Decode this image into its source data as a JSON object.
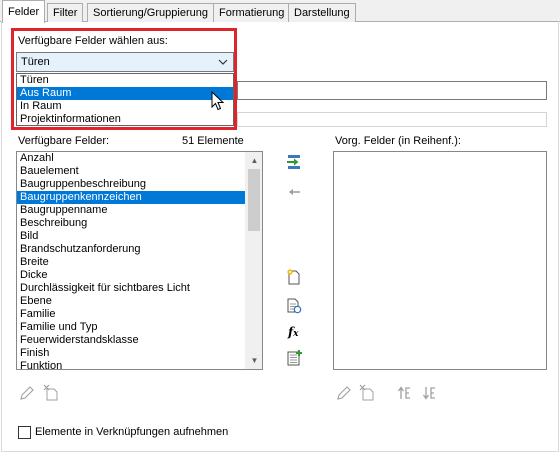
{
  "tabs": [
    "Felder",
    "Filter",
    "Sortierung/Gruppierung",
    "Formatierung",
    "Darstellung"
  ],
  "category_label": "Verfügbare Felder wählen aus:",
  "category_combo_value": "Türen",
  "category_options": [
    "Türen",
    "Aus Raum",
    "In Raum",
    "Projektinformationen"
  ],
  "available_label": "Verfügbare Felder:",
  "count_label": "51 Elemente",
  "available_fields": [
    "Anzahl",
    "Bauelement",
    "Baugruppenbeschreibung",
    "Baugruppenkennzeichen",
    "Baugruppenname",
    "Beschreibung",
    "Bild",
    "Brandschutzanforderung",
    "Breite",
    "Dicke",
    "Durchlässigkeit für sichtbares Licht",
    "Ebene",
    "Familie",
    "Familie und Typ",
    "Feuerwiderstandsklasse",
    "Finish",
    "Funktion"
  ],
  "selected_field": "Baugruppenkennzeichen",
  "scheduled_label": "Vorg. Felder (in Reihenf.):",
  "include_links_label": "Elemente in Verknüpfungen aufnehmen",
  "accent": "#0078d7",
  "highlight_border": "#e0242b"
}
